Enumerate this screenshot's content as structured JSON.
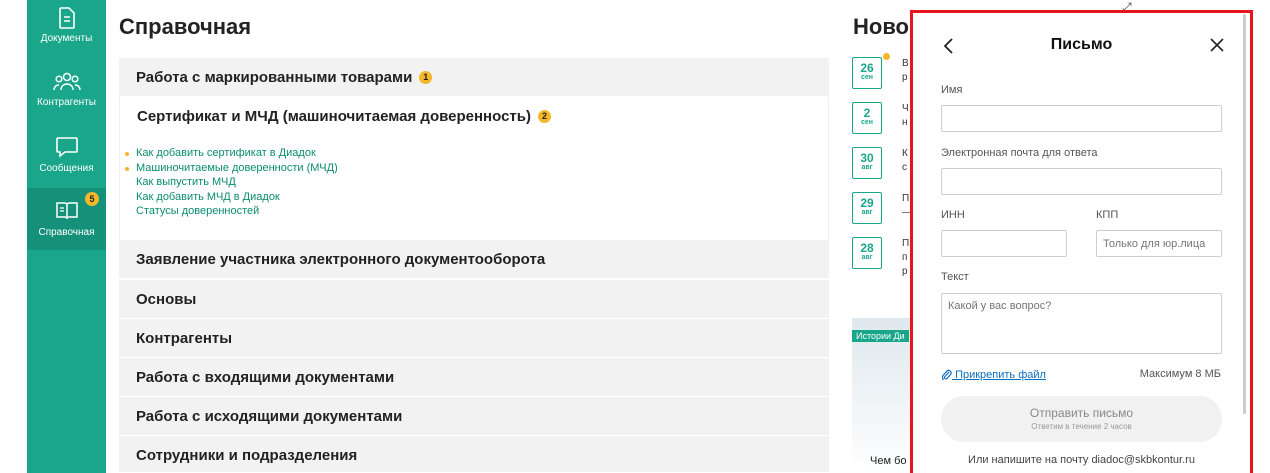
{
  "sidebar": {
    "items": [
      {
        "label": "Документы",
        "icon": "document-icon"
      },
      {
        "label": "Контрагенты",
        "icon": "people-icon"
      },
      {
        "label": "Сообщения",
        "icon": "chat-icon"
      },
      {
        "label": "Справочная",
        "icon": "book-icon",
        "badge": "5",
        "active": true
      }
    ]
  },
  "main": {
    "title": "Справочная",
    "sections": [
      {
        "title": "Работа с маркированными товарами",
        "badge": "1"
      },
      {
        "title": "Сертификат и МЧД (машиночитаемая доверенность)",
        "badge": "2"
      },
      {
        "title": "Заявление участника электронного документооборота"
      },
      {
        "title": "Основы"
      },
      {
        "title": "Контрагенты"
      },
      {
        "title": "Работа с входящими документами"
      },
      {
        "title": "Работа с исходящими документами"
      },
      {
        "title": "Сотрудники и подразделения"
      }
    ],
    "links": [
      "Как добавить сертификат в Диадок",
      "Машиночитаемые доверенности (МЧД)",
      "Как выпустить МЧД",
      "Как добавить МЧД в Диадок",
      "Статусы доверенностей"
    ]
  },
  "news": {
    "title": "Ново",
    "items": [
      {
        "day": "26",
        "month": "сен",
        "text": "В\nр"
      },
      {
        "day": "2",
        "month": "сен",
        "text": "Ч\nн"
      },
      {
        "day": "30",
        "month": "авг",
        "text": "К\nс"
      },
      {
        "day": "29",
        "month": "авг",
        "text": "П\n—"
      },
      {
        "day": "28",
        "month": "авг",
        "text": "П\nп\nр"
      }
    ],
    "story_tag": "Истории Ди",
    "story_caption": "Чем бо"
  },
  "letter": {
    "title": "Письмо",
    "name_label": "Имя",
    "email_label": "Электронная почта для ответа",
    "inn_label": "ИНН",
    "kpp_label": "КПП",
    "kpp_placeholder": "Только для юр.лица",
    "text_label": "Текст",
    "text_placeholder": "Какой у вас вопрос?",
    "attach_label": "Прикрепить файл",
    "max_size": "Максимум 8 МБ",
    "send_label": "Отправить письмо",
    "send_sub": "Ответим в течение 2 часов",
    "mail_note": "Или напишите на почту diadoc@skbkontur.ru"
  },
  "colors": {
    "accent": "#1aa68b",
    "badge": "#f4b72a",
    "highlight": "#e8141c",
    "link": "#0a8c6f"
  }
}
